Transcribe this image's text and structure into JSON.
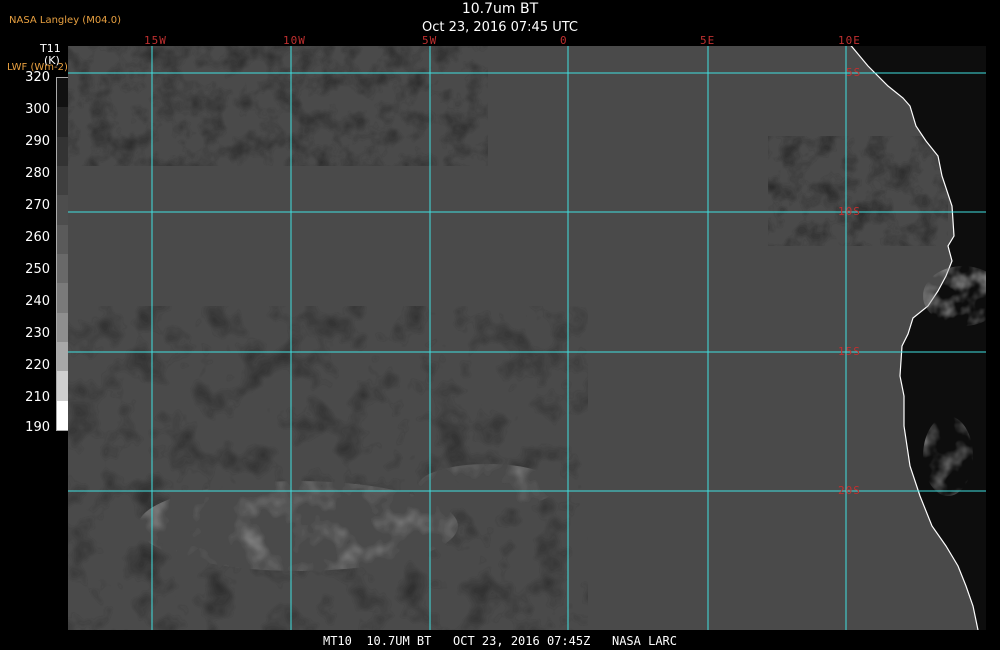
{
  "header": {
    "title": "10.7um BT",
    "subtitle": "Oct 23, 2016 07:45 UTC",
    "source": "NASA Langley (M04.0)"
  },
  "scale": {
    "label": "T11",
    "unit": "(K)",
    "lwf_label": "LWF (Wm-2)",
    "ticks": [
      "320",
      "300",
      "290",
      "280",
      "270",
      "260",
      "250",
      "240",
      "230",
      "220",
      "210",
      "190"
    ],
    "colors": [
      "#111111",
      "#262626",
      "#333333",
      "#404040",
      "#4d4d4d",
      "#5a5a5a",
      "#696969",
      "#7a7a7a",
      "#8e8e8e",
      "#a8a8a8",
      "#cfcfcf",
      "#ffffff"
    ]
  },
  "map": {
    "lon_labels": [
      "15W",
      "10W",
      "5W",
      "0",
      "5E",
      "10E"
    ],
    "lat_labels": [
      "5S",
      "10S",
      "15S",
      "20S"
    ],
    "grid_color": "#40e0e0",
    "ocean_color": "#4a4a4a",
    "land_color": "#0d0d0d",
    "coast_color": "#ffffff",
    "label_color": "#c03030"
  },
  "footer": {
    "text": "MT10  10.7UM BT   OCT 23, 2016 07:45Z   NASA LARC"
  }
}
